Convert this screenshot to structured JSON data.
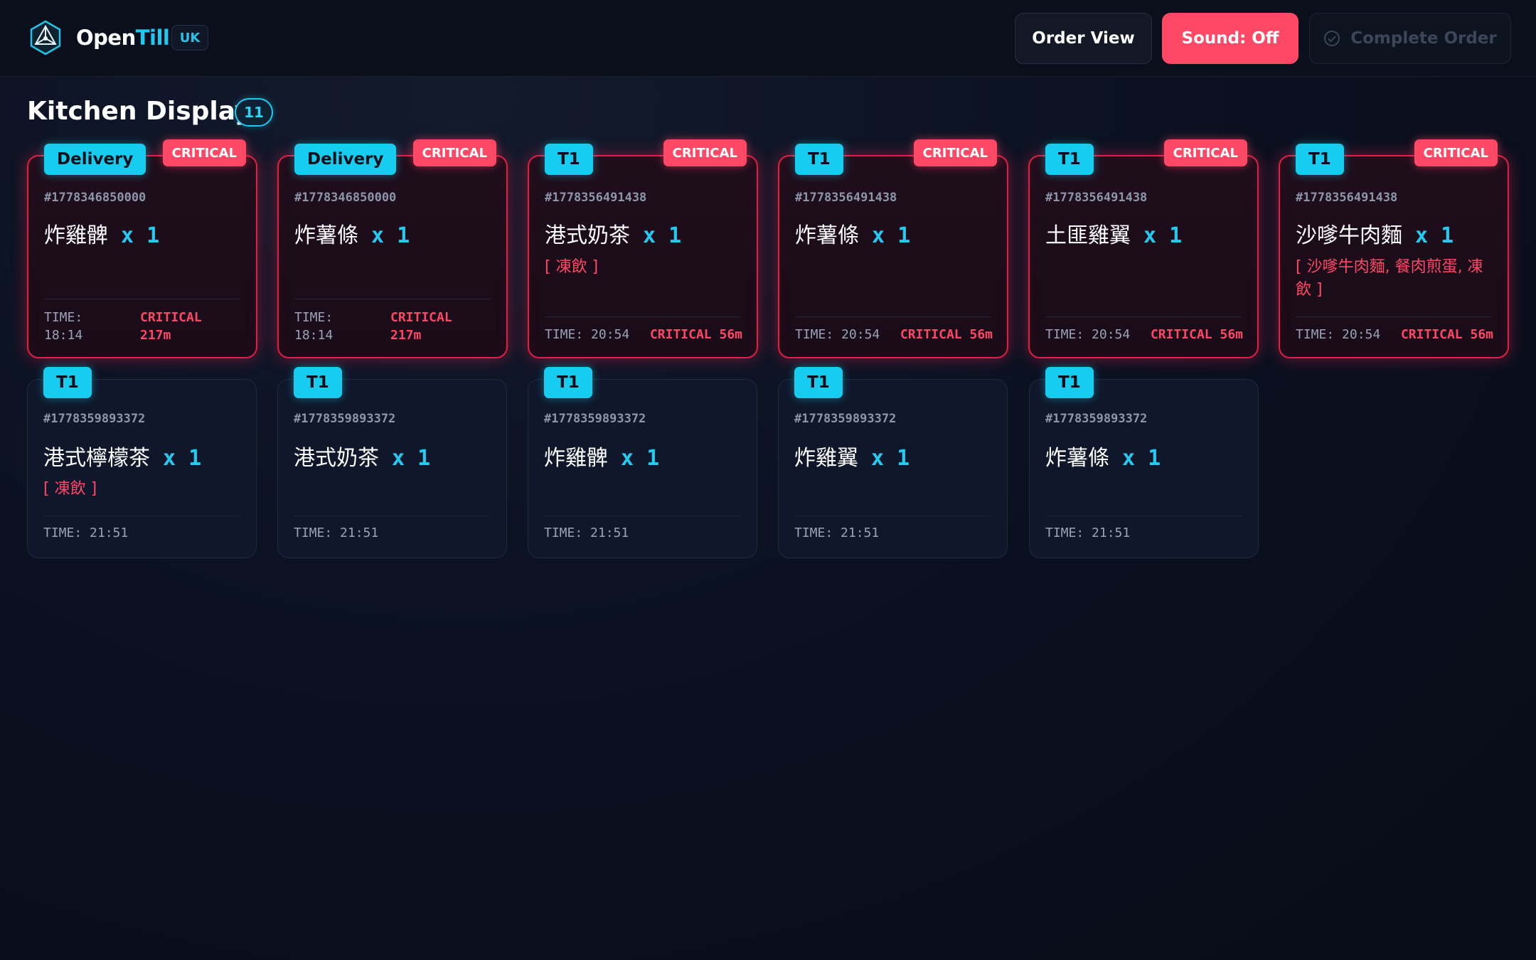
{
  "app": {
    "logo_open": "Open",
    "logo_till": "Till",
    "region": "UK"
  },
  "toolbar": {
    "order_view_label": "Order View",
    "sound_label": "Sound: Off",
    "complete_label": "Complete Order"
  },
  "page": {
    "title": "Kitchen Display",
    "count": "11"
  },
  "colors": {
    "accent_cyan": "#16cdf0",
    "critical_red": "#ff4766",
    "background": "#0b1020"
  },
  "tickets": [
    {
      "type": "Delivery",
      "status": "CRITICAL",
      "order_id": "#1778346850000",
      "item": "炸雞髀",
      "qty": "x 1",
      "note": "",
      "time_label": "TIME:",
      "time": "18:14",
      "crit_label": "CRITICAL",
      "crit_mins": "217m"
    },
    {
      "type": "Delivery",
      "status": "CRITICAL",
      "order_id": "#1778346850000",
      "item": "炸薯條",
      "qty": "x 1",
      "note": "",
      "time_label": "TIME:",
      "time": "18:14",
      "crit_label": "CRITICAL",
      "crit_mins": "217m"
    },
    {
      "type": "T1",
      "status": "CRITICAL",
      "order_id": "#1778356491438",
      "item": "港式奶茶",
      "qty": "x 1",
      "note": "[ 凍飲 ]",
      "time_text": "TIME: 20:54",
      "crit_text": "CRITICAL 56m"
    },
    {
      "type": "T1",
      "status": "CRITICAL",
      "order_id": "#1778356491438",
      "item": "炸薯條",
      "qty": "x 1",
      "note": "",
      "time_text": "TIME: 20:54",
      "crit_text": "CRITICAL 56m"
    },
    {
      "type": "T1",
      "status": "CRITICAL",
      "order_id": "#1778356491438",
      "item": "土匪雞翼",
      "qty": "x 1",
      "note": "",
      "time_text": "TIME: 20:54",
      "crit_text": "CRITICAL 56m"
    },
    {
      "type": "T1",
      "status": "CRITICAL",
      "order_id": "#1778356491438",
      "item": "沙嗲牛肉麵",
      "qty": "x 1",
      "note": "[ 沙嗲牛肉麵, 餐肉煎蛋, 凍飲 ]",
      "time_text": "TIME: 20:54",
      "crit_text": "CRITICAL 56m"
    },
    {
      "type": "T1",
      "order_id": "#1778359893372",
      "item": "港式檸檬茶",
      "qty": "x 1",
      "note": "[ 凍飲 ]",
      "time_text": "TIME: 21:51"
    },
    {
      "type": "T1",
      "order_id": "#1778359893372",
      "item": "港式奶茶",
      "qty": "x 1",
      "note": "",
      "time_text": "TIME: 21:51"
    },
    {
      "type": "T1",
      "order_id": "#1778359893372",
      "item": "炸雞髀",
      "qty": "x 1",
      "note": "",
      "time_text": "TIME: 21:51"
    },
    {
      "type": "T1",
      "order_id": "#1778359893372",
      "item": "炸雞翼",
      "qty": "x 1",
      "note": "",
      "time_text": "TIME: 21:51"
    },
    {
      "type": "T1",
      "order_id": "#1778359893372",
      "item": "炸薯條",
      "qty": "x 1",
      "note": "",
      "time_text": "TIME: 21:51"
    }
  ]
}
